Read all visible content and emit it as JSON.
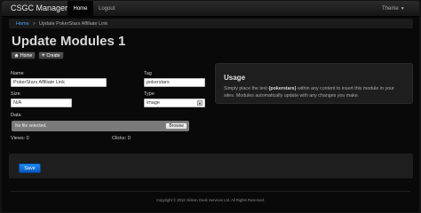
{
  "navbar": {
    "brand": "CSGC Manager",
    "home": "Home",
    "logout": "Logout",
    "theme": "Theme"
  },
  "breadcrumb": {
    "home": "Home",
    "separator": ">",
    "current": "Update PokerStars Affiliate Link"
  },
  "page_title": "Update Modules 1",
  "actions": {
    "home": "Home",
    "create": "Create"
  },
  "form": {
    "name_label": "Name",
    "name_value": "PokerStars Affiliate Link",
    "tag_label": "Tag",
    "tag_value": "pokerstars",
    "size_label": "Size",
    "size_value": "N/A",
    "type_label": "Type",
    "type_value": "image",
    "data_label": "Data",
    "file_status": "No file selected.",
    "browse": "Browse",
    "views": "Views: 0",
    "clicks": "Clicks: 0",
    "save": "Save"
  },
  "usage": {
    "title": "Usage",
    "text_before": "Simply place the text ",
    "token": "{pokerstars}",
    "text_after": " within any content to insert this module in your sites. Modules automatically update with any changes you make."
  },
  "footer": "Copyright © 2012 Aldeon Geek Services Ltd. All Rights Reserved."
}
